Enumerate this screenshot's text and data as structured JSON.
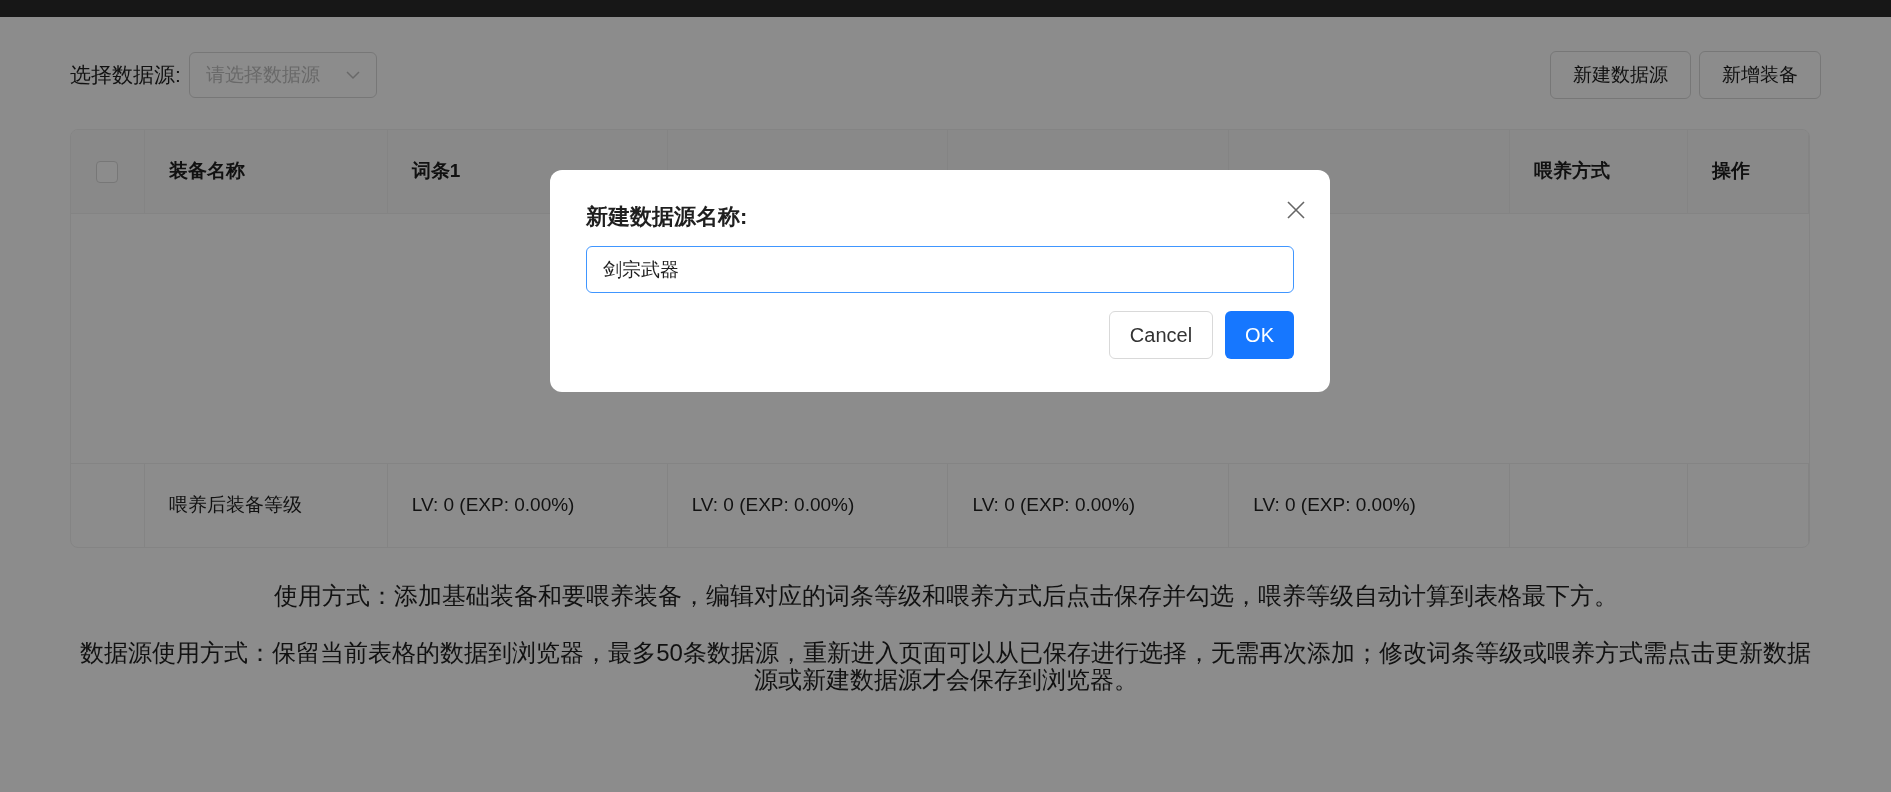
{
  "toolbar": {
    "select_label": "选择数据源:",
    "select": {
      "placeholder": "请选择数据源"
    },
    "buttons": [
      "新建数据源",
      "新增装备"
    ]
  },
  "table": {
    "select_all": {
      "checked": false
    },
    "columns": [
      {
        "label": "装备名称"
      },
      {
        "label": "词条1"
      },
      {},
      {},
      {},
      {
        "label": "喂养方式"
      },
      {
        "label": "操作"
      }
    ],
    "summary_row": [
      "喂养后装备等级",
      "LV: 0 (EXP: 0.00%)",
      "LV: 0 (EXP: 0.00%)",
      "LV: 0 (EXP: 0.00%)",
      "LV: 0 (EXP: 0.00%)"
    ]
  },
  "notes": [
    "使用方式：添加基础装备和要喂养装备，编辑对应的词条等级和喂养方式后点击保存并勾选，喂养等级自动计算到表格最下方。",
    "数据源使用方式：保留当前表格的数据到浏览器，最多50条数据源，重新进入页面可以从已保存进行选择，无需再次添加；修改词条等级或喂养方式需点击更新数据源或新建数据源才会保存到浏览器。"
  ],
  "dialog": {
    "title": "新建数据源名称:",
    "input": {
      "value": "剑宗武器"
    },
    "buttons": [
      {
        "kind": "secondary",
        "label": "Cancel"
      },
      {
        "kind": "primary",
        "label": "OK"
      }
    ]
  }
}
